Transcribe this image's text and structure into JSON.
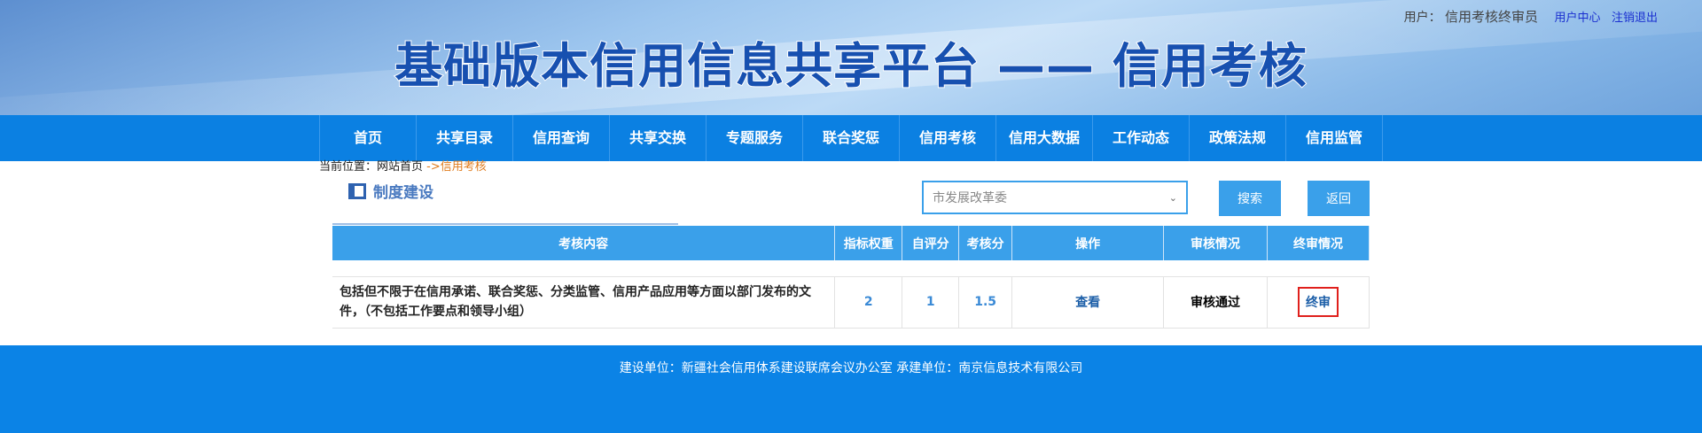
{
  "header": {
    "title": "基础版本信用信息共享平台 —— 信用考核",
    "user_label": "用户：",
    "user_name": "信用考核终审员",
    "user_center": "用户中心",
    "logout": "注销退出"
  },
  "nav": [
    "首页",
    "共享目录",
    "信用查询",
    "共享交换",
    "专题服务",
    "联合奖惩",
    "信用考核",
    "信用大数据",
    "工作动态",
    "政策法规",
    "信用监管"
  ],
  "breadcrumb": {
    "prefix": "当前位置：",
    "home": "网站首页",
    "sep": " ->",
    "current": "信用考核"
  },
  "section": {
    "title": "制度建设"
  },
  "filter": {
    "department": "市发展改革委",
    "search": "搜索",
    "back": "返回"
  },
  "table": {
    "headers": [
      "考核内容",
      "指标权重",
      "自评分",
      "考核分",
      "操作",
      "审核情况",
      "终审情况"
    ],
    "rows": [
      {
        "content": "包括但不限于在信用承诺、联合奖惩、分类监管、信用产品应用等方面以部门发布的文件，（不包括工作要点和领导小组）",
        "weight": "2",
        "self_score": "1",
        "score": "1.5",
        "action": "查看",
        "review": "审核通过",
        "final": "终审"
      }
    ]
  },
  "footer": {
    "text": "建设单位：新疆社会信用体系建设联席会议办公室 承建单位：南京信息技术有限公司"
  }
}
